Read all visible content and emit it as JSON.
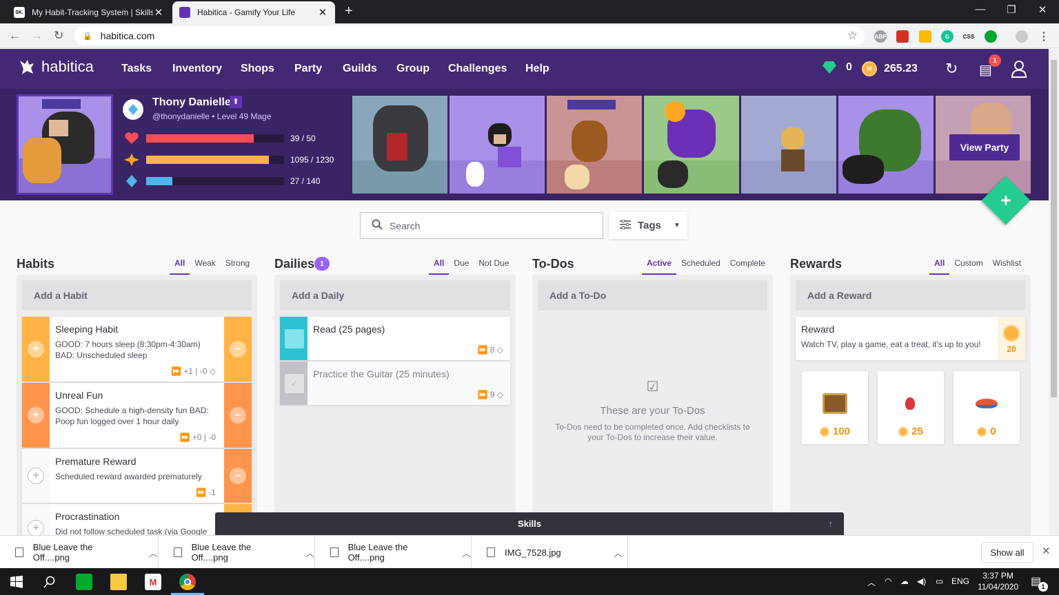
{
  "browser": {
    "tabs": [
      {
        "title": "My Habit-Tracking System | Skillsh",
        "favicon": "SK."
      },
      {
        "title": "Habitica - Gamify Your Life"
      }
    ],
    "url": "habitica.com",
    "extensions": [
      "ABP",
      "CSS"
    ]
  },
  "nav": {
    "brand": "habitica",
    "links": [
      "Tasks",
      "Inventory",
      "Shops",
      "Party",
      "Guilds",
      "Group",
      "Challenges",
      "Help"
    ],
    "gems": "0",
    "gold": "265.23",
    "notification_count": "1"
  },
  "user": {
    "name": "Thony Danielle",
    "handle_level": "@thonydanielle • Level 49 Mage",
    "health": {
      "value": "39 / 50",
      "fraction": 0.78
    },
    "experience": {
      "value": "1095 / 1230",
      "fraction": 0.89
    },
    "mana": {
      "value": "27 / 140",
      "fraction": 0.19
    },
    "view_party_label": "View Party"
  },
  "controls": {
    "search_placeholder": "Search",
    "tags_label": "Tags"
  },
  "habits": {
    "title": "Habits",
    "filters": [
      "All",
      "Weak",
      "Strong"
    ],
    "add_label": "Add a Habit",
    "items": [
      {
        "title": "Sleeping Habit",
        "notes": "GOOD: 7 hours sleep (8:30pm-4:30am) BAD: Unscheduled sleep",
        "meta": "+1 | -0",
        "color": "#ffb445"
      },
      {
        "title": "Unreal Fun",
        "notes": "GOOD: Schedule a high-density fun BAD: Poop fun logged over 1 hour daily",
        "meta": "+0 | -0",
        "color": "#ff944c"
      },
      {
        "title": "Premature Reward",
        "notes": "Scheduled reward awarded prematurely",
        "meta": "-1",
        "color": "#ff944c"
      },
      {
        "title": "Procrastination",
        "notes": "Did not follow scheduled task (via Google"
      }
    ]
  },
  "dailies": {
    "title": "Dailies",
    "badge": "1",
    "filters": [
      "All",
      "Due",
      "Not Due"
    ],
    "add_label": "Add a Daily",
    "items": [
      {
        "title": "Read (25 pages)",
        "meta": "8",
        "color": "#50b5e9"
      },
      {
        "title": "Practice the Guitar (25 minutes)",
        "meta": "9"
      }
    ]
  },
  "todos": {
    "title": "To-Dos",
    "filters": [
      "Active",
      "Scheduled",
      "Complete"
    ],
    "add_label": "Add a To-Do",
    "empty_title": "These are your To-Dos",
    "empty_text": "To-Dos need to be completed once. Add checklists to your To-Dos to increase their value."
  },
  "rewards": {
    "title": "Rewards",
    "filters": [
      "All",
      "Custom",
      "Wishlist"
    ],
    "add_label": "Add a Reward",
    "custom": {
      "title": "Reward",
      "notes": "Watch TV, play a game, eat a treat, it's up to you!",
      "price": "20"
    },
    "shop_items": [
      {
        "icon": "treasure-chest-icon",
        "price": "100"
      },
      {
        "icon": "health-potion-icon",
        "price": "25"
      },
      {
        "icon": "food-bowl-icon",
        "price": "0"
      }
    ]
  },
  "skills_label": "Skills",
  "downloads": {
    "items": [
      "Blue Leave the Off....png",
      "Blue Leave the Off....png",
      "Blue Leave the Off....png",
      "IMG_7528.jpg"
    ],
    "show_all": "Show all"
  },
  "taskbar": {
    "lang": "ENG",
    "time": "3:37 PM",
    "date": "11/04/2020",
    "notif": "1"
  }
}
